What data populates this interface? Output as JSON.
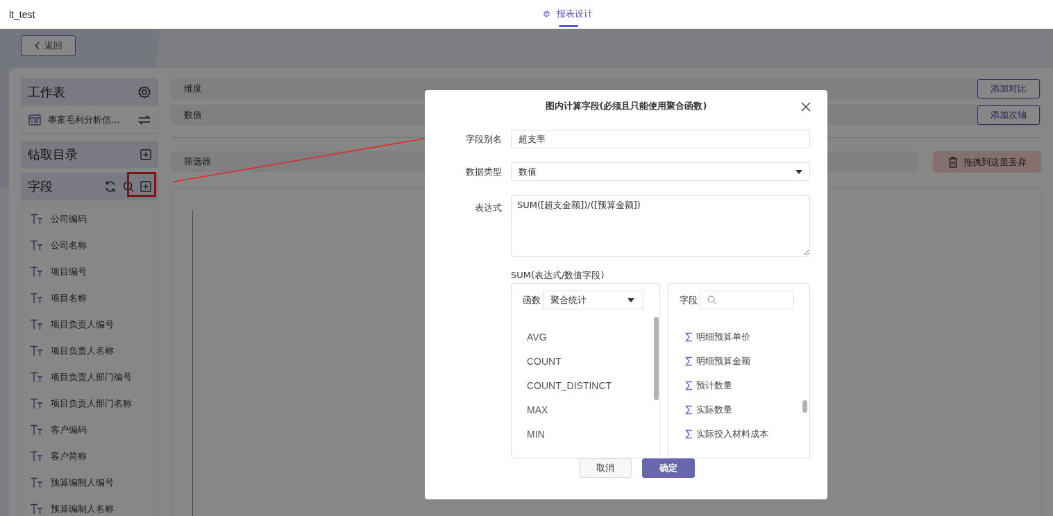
{
  "top_bar": {
    "app_name": "lt_test",
    "tabs": [
      {
        "label": "报表设计",
        "selected": true
      }
    ]
  },
  "back_button": "返回",
  "sidebar": {
    "worksheet": {
      "title": "工作表",
      "table": "專案毛利分析信..."
    },
    "drill": {
      "title": "钻取目录"
    },
    "fields": {
      "title": "字段",
      "items": [
        "公司编码",
        "公司名称",
        "项目编号",
        "项目名称",
        "项目负责人编号",
        "项目负责人名称",
        "项目负责人部门编号",
        "项目负责人部门名称",
        "客户编码",
        "客户简称",
        "预算编制人编号",
        "预算编制人名称"
      ]
    }
  },
  "shelves": [
    {
      "label": "维度",
      "button": "添加对比"
    },
    {
      "label": "数值",
      "button": "添加次轴"
    }
  ],
  "filter": {
    "label": "筛选器",
    "trash": "拖拽到这里丢弃"
  },
  "dialog": {
    "title": "图内计算字段(必须且只能使用聚合函数)",
    "alias": {
      "label": "字段别名",
      "value": "超支率"
    },
    "data_type": {
      "label": "数据类型",
      "value": "数值"
    },
    "expression": {
      "label": "表达式",
      "value": "SUM([超支金额])/([预算金额])"
    },
    "hint": "SUM(表达式/数值字段)",
    "functions": {
      "label": "函数",
      "category": "聚合统计",
      "items": [
        "AVG",
        "COUNT",
        "COUNT_DISTINCT",
        "MAX",
        "MIN"
      ]
    },
    "fields": {
      "label": "字段",
      "items": [
        "明细预算单价",
        "明细预算金额",
        "预计数量",
        "实际数量",
        "实际投入材料成本"
      ]
    },
    "buttons": [
      {
        "label": "取消",
        "kind": "secondary"
      },
      {
        "label": "确定",
        "kind": "primary"
      }
    ]
  }
}
